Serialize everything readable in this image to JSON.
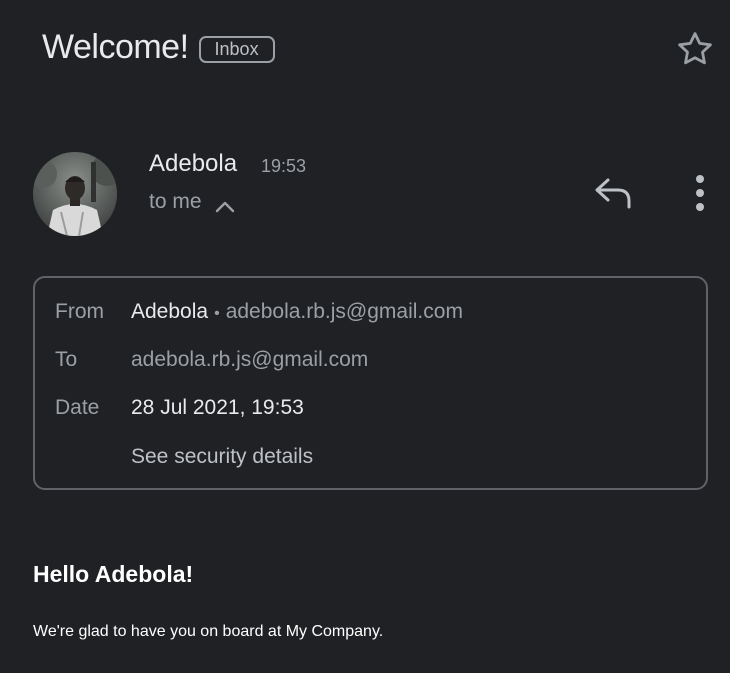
{
  "header": {
    "subject": "Welcome!",
    "label": "Inbox"
  },
  "sender": {
    "name": "Adebola",
    "time": "19:53",
    "recipient_summary": "to me"
  },
  "details": {
    "from_label": "From",
    "from_name": "Adebola",
    "separator": "•",
    "from_email": "adebola.rb.js@gmail.com",
    "to_label": "To",
    "to_email": "adebola.rb.js@gmail.com",
    "date_label": "Date",
    "date_value": "28 Jul 2021, 19:53",
    "security_link": "See security details"
  },
  "message": {
    "heading": "Hello Adebola!",
    "paragraph": "We're glad to have you on board at My Company."
  },
  "icons": {
    "star": "star-outline-icon",
    "chevron": "chevron-up-icon",
    "reply": "reply-icon",
    "more": "more-vert-icon"
  },
  "colors": {
    "background": "#202124",
    "primary_text": "#e8eaed",
    "secondary_text": "#9aa0a6",
    "border": "#5f6368"
  }
}
